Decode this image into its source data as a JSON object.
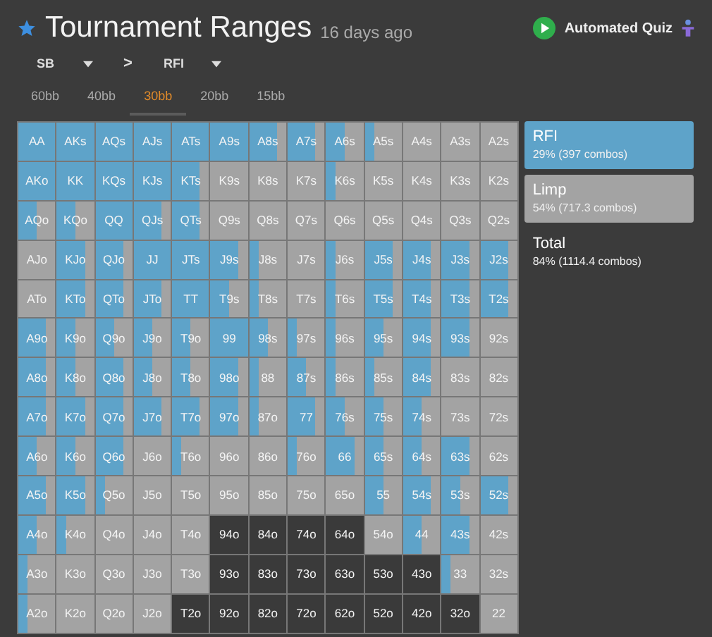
{
  "header": {
    "title": "Tournament Ranges",
    "age": "16 days ago",
    "quiz_label": "Automated Quiz"
  },
  "selectors": [
    {
      "kind": "dropdown",
      "label": "SB"
    },
    {
      "kind": "separator",
      "label": ">"
    },
    {
      "kind": "dropdown",
      "label": "RFI"
    }
  ],
  "tabs": [
    {
      "label": "60bb",
      "selected": false
    },
    {
      "label": "40bb",
      "selected": false
    },
    {
      "label": "30bb",
      "selected": true
    },
    {
      "label": "20bb",
      "selected": false
    },
    {
      "label": "15bb",
      "selected": false
    }
  ],
  "grid": [
    [
      {
        "label": "AA",
        "kind": "raise"
      },
      {
        "label": "AKs",
        "kind": "raise"
      },
      {
        "label": "AQs",
        "kind": "raise"
      },
      {
        "label": "AJs",
        "kind": "raise"
      },
      {
        "label": "ATs",
        "kind": "raise"
      },
      {
        "label": "A9s",
        "kind": "raise"
      },
      {
        "label": "A8s",
        "kind": "mostly_raise"
      },
      {
        "label": "A7s",
        "kind": "mostly_raise"
      },
      {
        "label": "A6s",
        "kind": "mixed"
      },
      {
        "label": "A5s",
        "kind": "mostly_limp"
      },
      {
        "label": "A4s",
        "kind": "limp"
      },
      {
        "label": "A3s",
        "kind": "limp"
      },
      {
        "label": "A2s",
        "kind": "limp"
      }
    ],
    [
      {
        "label": "AKo",
        "kind": "raise"
      },
      {
        "label": "KK",
        "kind": "raise"
      },
      {
        "label": "KQs",
        "kind": "raise"
      },
      {
        "label": "KJs",
        "kind": "raise"
      },
      {
        "label": "KTs",
        "kind": "mostly_raise"
      },
      {
        "label": "K9s",
        "kind": "limp"
      },
      {
        "label": "K8s",
        "kind": "limp"
      },
      {
        "label": "K7s",
        "kind": "limp"
      },
      {
        "label": "K6s",
        "kind": "mostly_limp"
      },
      {
        "label": "K5s",
        "kind": "limp"
      },
      {
        "label": "K4s",
        "kind": "limp"
      },
      {
        "label": "K3s",
        "kind": "limp"
      },
      {
        "label": "K2s",
        "kind": "limp"
      }
    ],
    [
      {
        "label": "AQo",
        "kind": "mixed"
      },
      {
        "label": "KQo",
        "kind": "mixed"
      },
      {
        "label": "QQ",
        "kind": "raise"
      },
      {
        "label": "QJs",
        "kind": "mostly_raise"
      },
      {
        "label": "QTs",
        "kind": "mostly_raise"
      },
      {
        "label": "Q9s",
        "kind": "limp"
      },
      {
        "label": "Q8s",
        "kind": "limp"
      },
      {
        "label": "Q7s",
        "kind": "limp"
      },
      {
        "label": "Q6s",
        "kind": "limp"
      },
      {
        "label": "Q5s",
        "kind": "limp"
      },
      {
        "label": "Q4s",
        "kind": "limp"
      },
      {
        "label": "Q3s",
        "kind": "limp"
      },
      {
        "label": "Q2s",
        "kind": "limp"
      }
    ],
    [
      {
        "label": "AJo",
        "kind": "limp"
      },
      {
        "label": "KJo",
        "kind": "mostly_raise"
      },
      {
        "label": "QJo",
        "kind": "mostly_raise"
      },
      {
        "label": "JJ",
        "kind": "raise"
      },
      {
        "label": "JTs",
        "kind": "raise"
      },
      {
        "label": "J9s",
        "kind": "mostly_raise"
      },
      {
        "label": "J8s",
        "kind": "mostly_limp"
      },
      {
        "label": "J7s",
        "kind": "limp"
      },
      {
        "label": "J6s",
        "kind": "mostly_limp"
      },
      {
        "label": "J5s",
        "kind": "mostly_raise"
      },
      {
        "label": "J4s",
        "kind": "mostly_raise"
      },
      {
        "label": "J3s",
        "kind": "mostly_raise"
      },
      {
        "label": "J2s",
        "kind": "mostly_raise"
      }
    ],
    [
      {
        "label": "ATo",
        "kind": "limp"
      },
      {
        "label": "KTo",
        "kind": "mostly_raise"
      },
      {
        "label": "QTo",
        "kind": "mostly_raise"
      },
      {
        "label": "JTo",
        "kind": "mostly_raise"
      },
      {
        "label": "TT",
        "kind": "raise"
      },
      {
        "label": "T9s",
        "kind": "mixed"
      },
      {
        "label": "T8s",
        "kind": "mostly_limp"
      },
      {
        "label": "T7s",
        "kind": "limp"
      },
      {
        "label": "T6s",
        "kind": "mostly_limp"
      },
      {
        "label": "T5s",
        "kind": "mostly_raise"
      },
      {
        "label": "T4s",
        "kind": "mostly_raise"
      },
      {
        "label": "T3s",
        "kind": "mostly_raise"
      },
      {
        "label": "T2s",
        "kind": "mostly_raise"
      }
    ],
    [
      {
        "label": "A9o",
        "kind": "mostly_raise"
      },
      {
        "label": "K9o",
        "kind": "mixed"
      },
      {
        "label": "Q9o",
        "kind": "mixed"
      },
      {
        "label": "J9o",
        "kind": "mixed"
      },
      {
        "label": "T9o",
        "kind": "mixed"
      },
      {
        "label": "99",
        "kind": "raise"
      },
      {
        "label": "98s",
        "kind": "mixed"
      },
      {
        "label": "97s",
        "kind": "mostly_limp"
      },
      {
        "label": "96s",
        "kind": "mostly_limp"
      },
      {
        "label": "95s",
        "kind": "mixed"
      },
      {
        "label": "94s",
        "kind": "mostly_raise"
      },
      {
        "label": "93s",
        "kind": "mostly_raise"
      },
      {
        "label": "92s",
        "kind": "limp"
      }
    ],
    [
      {
        "label": "A8o",
        "kind": "mostly_raise"
      },
      {
        "label": "K8o",
        "kind": "mixed"
      },
      {
        "label": "Q8o",
        "kind": "mostly_raise"
      },
      {
        "label": "J8o",
        "kind": "mixed"
      },
      {
        "label": "T8o",
        "kind": "mixed"
      },
      {
        "label": "98o",
        "kind": "mostly_raise"
      },
      {
        "label": "88",
        "kind": "mostly_limp"
      },
      {
        "label": "87s",
        "kind": "mixed"
      },
      {
        "label": "86s",
        "kind": "mostly_limp"
      },
      {
        "label": "85s",
        "kind": "mostly_limp"
      },
      {
        "label": "84s",
        "kind": "mostly_raise"
      },
      {
        "label": "83s",
        "kind": "limp"
      },
      {
        "label": "82s",
        "kind": "limp"
      }
    ],
    [
      {
        "label": "A7o",
        "kind": "mostly_raise"
      },
      {
        "label": "K7o",
        "kind": "mostly_raise"
      },
      {
        "label": "Q7o",
        "kind": "mostly_raise"
      },
      {
        "label": "J7o",
        "kind": "mostly_raise"
      },
      {
        "label": "T7o",
        "kind": "mostly_raise"
      },
      {
        "label": "97o",
        "kind": "mostly_raise"
      },
      {
        "label": "87o",
        "kind": "mostly_limp"
      },
      {
        "label": "77",
        "kind": "mostly_raise"
      },
      {
        "label": "76s",
        "kind": "mixed"
      },
      {
        "label": "75s",
        "kind": "mixed"
      },
      {
        "label": "74s",
        "kind": "mixed"
      },
      {
        "label": "73s",
        "kind": "limp"
      },
      {
        "label": "72s",
        "kind": "limp"
      }
    ],
    [
      {
        "label": "A6o",
        "kind": "mixed"
      },
      {
        "label": "K6o",
        "kind": "mixed"
      },
      {
        "label": "Q6o",
        "kind": "mostly_raise"
      },
      {
        "label": "J6o",
        "kind": "limp"
      },
      {
        "label": "T6o",
        "kind": "mostly_limp"
      },
      {
        "label": "96o",
        "kind": "limp"
      },
      {
        "label": "86o",
        "kind": "limp"
      },
      {
        "label": "76o",
        "kind": "mostly_limp"
      },
      {
        "label": "66",
        "kind": "mostly_raise"
      },
      {
        "label": "65s",
        "kind": "mixed"
      },
      {
        "label": "64s",
        "kind": "mixed"
      },
      {
        "label": "63s",
        "kind": "mostly_raise"
      },
      {
        "label": "62s",
        "kind": "limp"
      }
    ],
    [
      {
        "label": "A5o",
        "kind": "mostly_raise"
      },
      {
        "label": "K5o",
        "kind": "mostly_raise"
      },
      {
        "label": "Q5o",
        "kind": "mostly_limp"
      },
      {
        "label": "J5o",
        "kind": "limp"
      },
      {
        "label": "T5o",
        "kind": "limp"
      },
      {
        "label": "95o",
        "kind": "limp"
      },
      {
        "label": "85o",
        "kind": "limp"
      },
      {
        "label": "75o",
        "kind": "limp"
      },
      {
        "label": "65o",
        "kind": "limp"
      },
      {
        "label": "55",
        "kind": "mixed"
      },
      {
        "label": "54s",
        "kind": "mostly_raise"
      },
      {
        "label": "53s",
        "kind": "mixed"
      },
      {
        "label": "52s",
        "kind": "mostly_raise"
      }
    ],
    [
      {
        "label": "A4o",
        "kind": "mixed"
      },
      {
        "label": "K4o",
        "kind": "mostly_limp"
      },
      {
        "label": "Q4o",
        "kind": "limp"
      },
      {
        "label": "J4o",
        "kind": "limp"
      },
      {
        "label": "T4o",
        "kind": "limp"
      },
      {
        "label": "94o",
        "kind": "fold"
      },
      {
        "label": "84o",
        "kind": "fold"
      },
      {
        "label": "74o",
        "kind": "fold"
      },
      {
        "label": "64o",
        "kind": "fold"
      },
      {
        "label": "54o",
        "kind": "limp"
      },
      {
        "label": "44",
        "kind": "mixed"
      },
      {
        "label": "43s",
        "kind": "mostly_raise"
      },
      {
        "label": "42s",
        "kind": "limp"
      }
    ],
    [
      {
        "label": "A3o",
        "kind": "mostly_limp"
      },
      {
        "label": "K3o",
        "kind": "limp"
      },
      {
        "label": "Q3o",
        "kind": "limp"
      },
      {
        "label": "J3o",
        "kind": "limp"
      },
      {
        "label": "T3o",
        "kind": "limp"
      },
      {
        "label": "93o",
        "kind": "fold"
      },
      {
        "label": "83o",
        "kind": "fold"
      },
      {
        "label": "73o",
        "kind": "fold"
      },
      {
        "label": "63o",
        "kind": "fold"
      },
      {
        "label": "53o",
        "kind": "fold"
      },
      {
        "label": "43o",
        "kind": "fold"
      },
      {
        "label": "33",
        "kind": "mostly_limp"
      },
      {
        "label": "32s",
        "kind": "limp"
      }
    ],
    [
      {
        "label": "A2o",
        "kind": "mostly_limp"
      },
      {
        "label": "K2o",
        "kind": "limp"
      },
      {
        "label": "Q2o",
        "kind": "limp"
      },
      {
        "label": "J2o",
        "kind": "limp"
      },
      {
        "label": "T2o",
        "kind": "fold"
      },
      {
        "label": "92o",
        "kind": "fold"
      },
      {
        "label": "82o",
        "kind": "fold"
      },
      {
        "label": "72o",
        "kind": "fold"
      },
      {
        "label": "62o",
        "kind": "fold"
      },
      {
        "label": "52o",
        "kind": "fold"
      },
      {
        "label": "42o",
        "kind": "fold"
      },
      {
        "label": "32o",
        "kind": "fold"
      },
      {
        "label": "22",
        "kind": "limp"
      }
    ]
  ],
  "legend": [
    {
      "name": "RFI",
      "detail": "29% (397 combos)",
      "color": "#5ea3c9"
    },
    {
      "name": "Limp",
      "detail": "54% (717.3 combos)",
      "color": "#a3a3a3"
    },
    {
      "name": "Total",
      "detail": "84% (1114.4 combos)"
    }
  ]
}
